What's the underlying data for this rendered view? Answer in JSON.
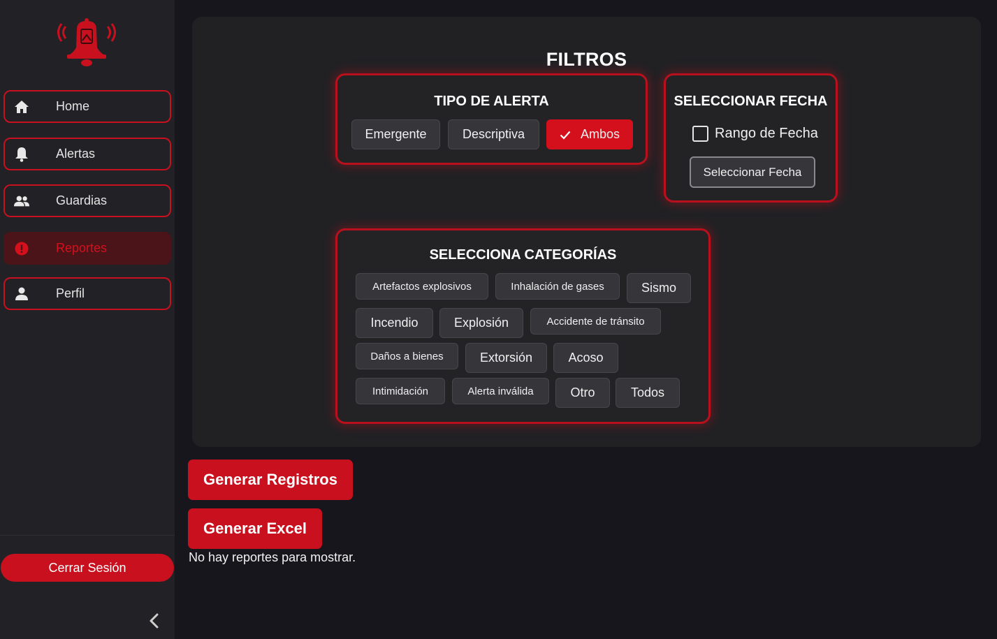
{
  "sidebar": {
    "items": [
      {
        "label": "Home",
        "icon": "home-icon"
      },
      {
        "label": "Alertas",
        "icon": "bell-icon"
      },
      {
        "label": "Guardias",
        "icon": "people-icon"
      },
      {
        "label": "Reportes",
        "icon": "alert-circle-icon",
        "active": true
      },
      {
        "label": "Perfil",
        "icon": "person-icon"
      }
    ],
    "logout_label": "Cerrar Sesión"
  },
  "filters": {
    "title": "FILTROS",
    "alert_type": {
      "title": "TIPO DE ALERTA",
      "options": [
        "Emergente",
        "Descriptiva",
        "Ambos"
      ],
      "selected": "Ambos"
    },
    "date": {
      "title": "SELECCIONAR FECHA",
      "range_label": "Rango de Fecha",
      "range_checked": false,
      "button_label": "Seleccionar Fecha"
    },
    "categories": {
      "title": "SELECCIONA CATEGORÍAS",
      "items": [
        "Artefactos explosivos",
        "Inhalación de gases",
        "Sismo",
        "Incendio",
        "Explosión",
        "Accidente de tránsito",
        "Daños a bienes",
        "Extorsión",
        "Acoso",
        "Intimidación",
        "Alerta inválida",
        "Otro",
        "Todos"
      ]
    }
  },
  "actions": {
    "generate_records": "Generar Registros",
    "generate_excel": "Generar Excel"
  },
  "empty_message": "No hay reportes para mostrar.",
  "colors": {
    "accent": "#c8101e",
    "background": "#16161c",
    "sidebar": "#222226",
    "panel": "#212124"
  }
}
